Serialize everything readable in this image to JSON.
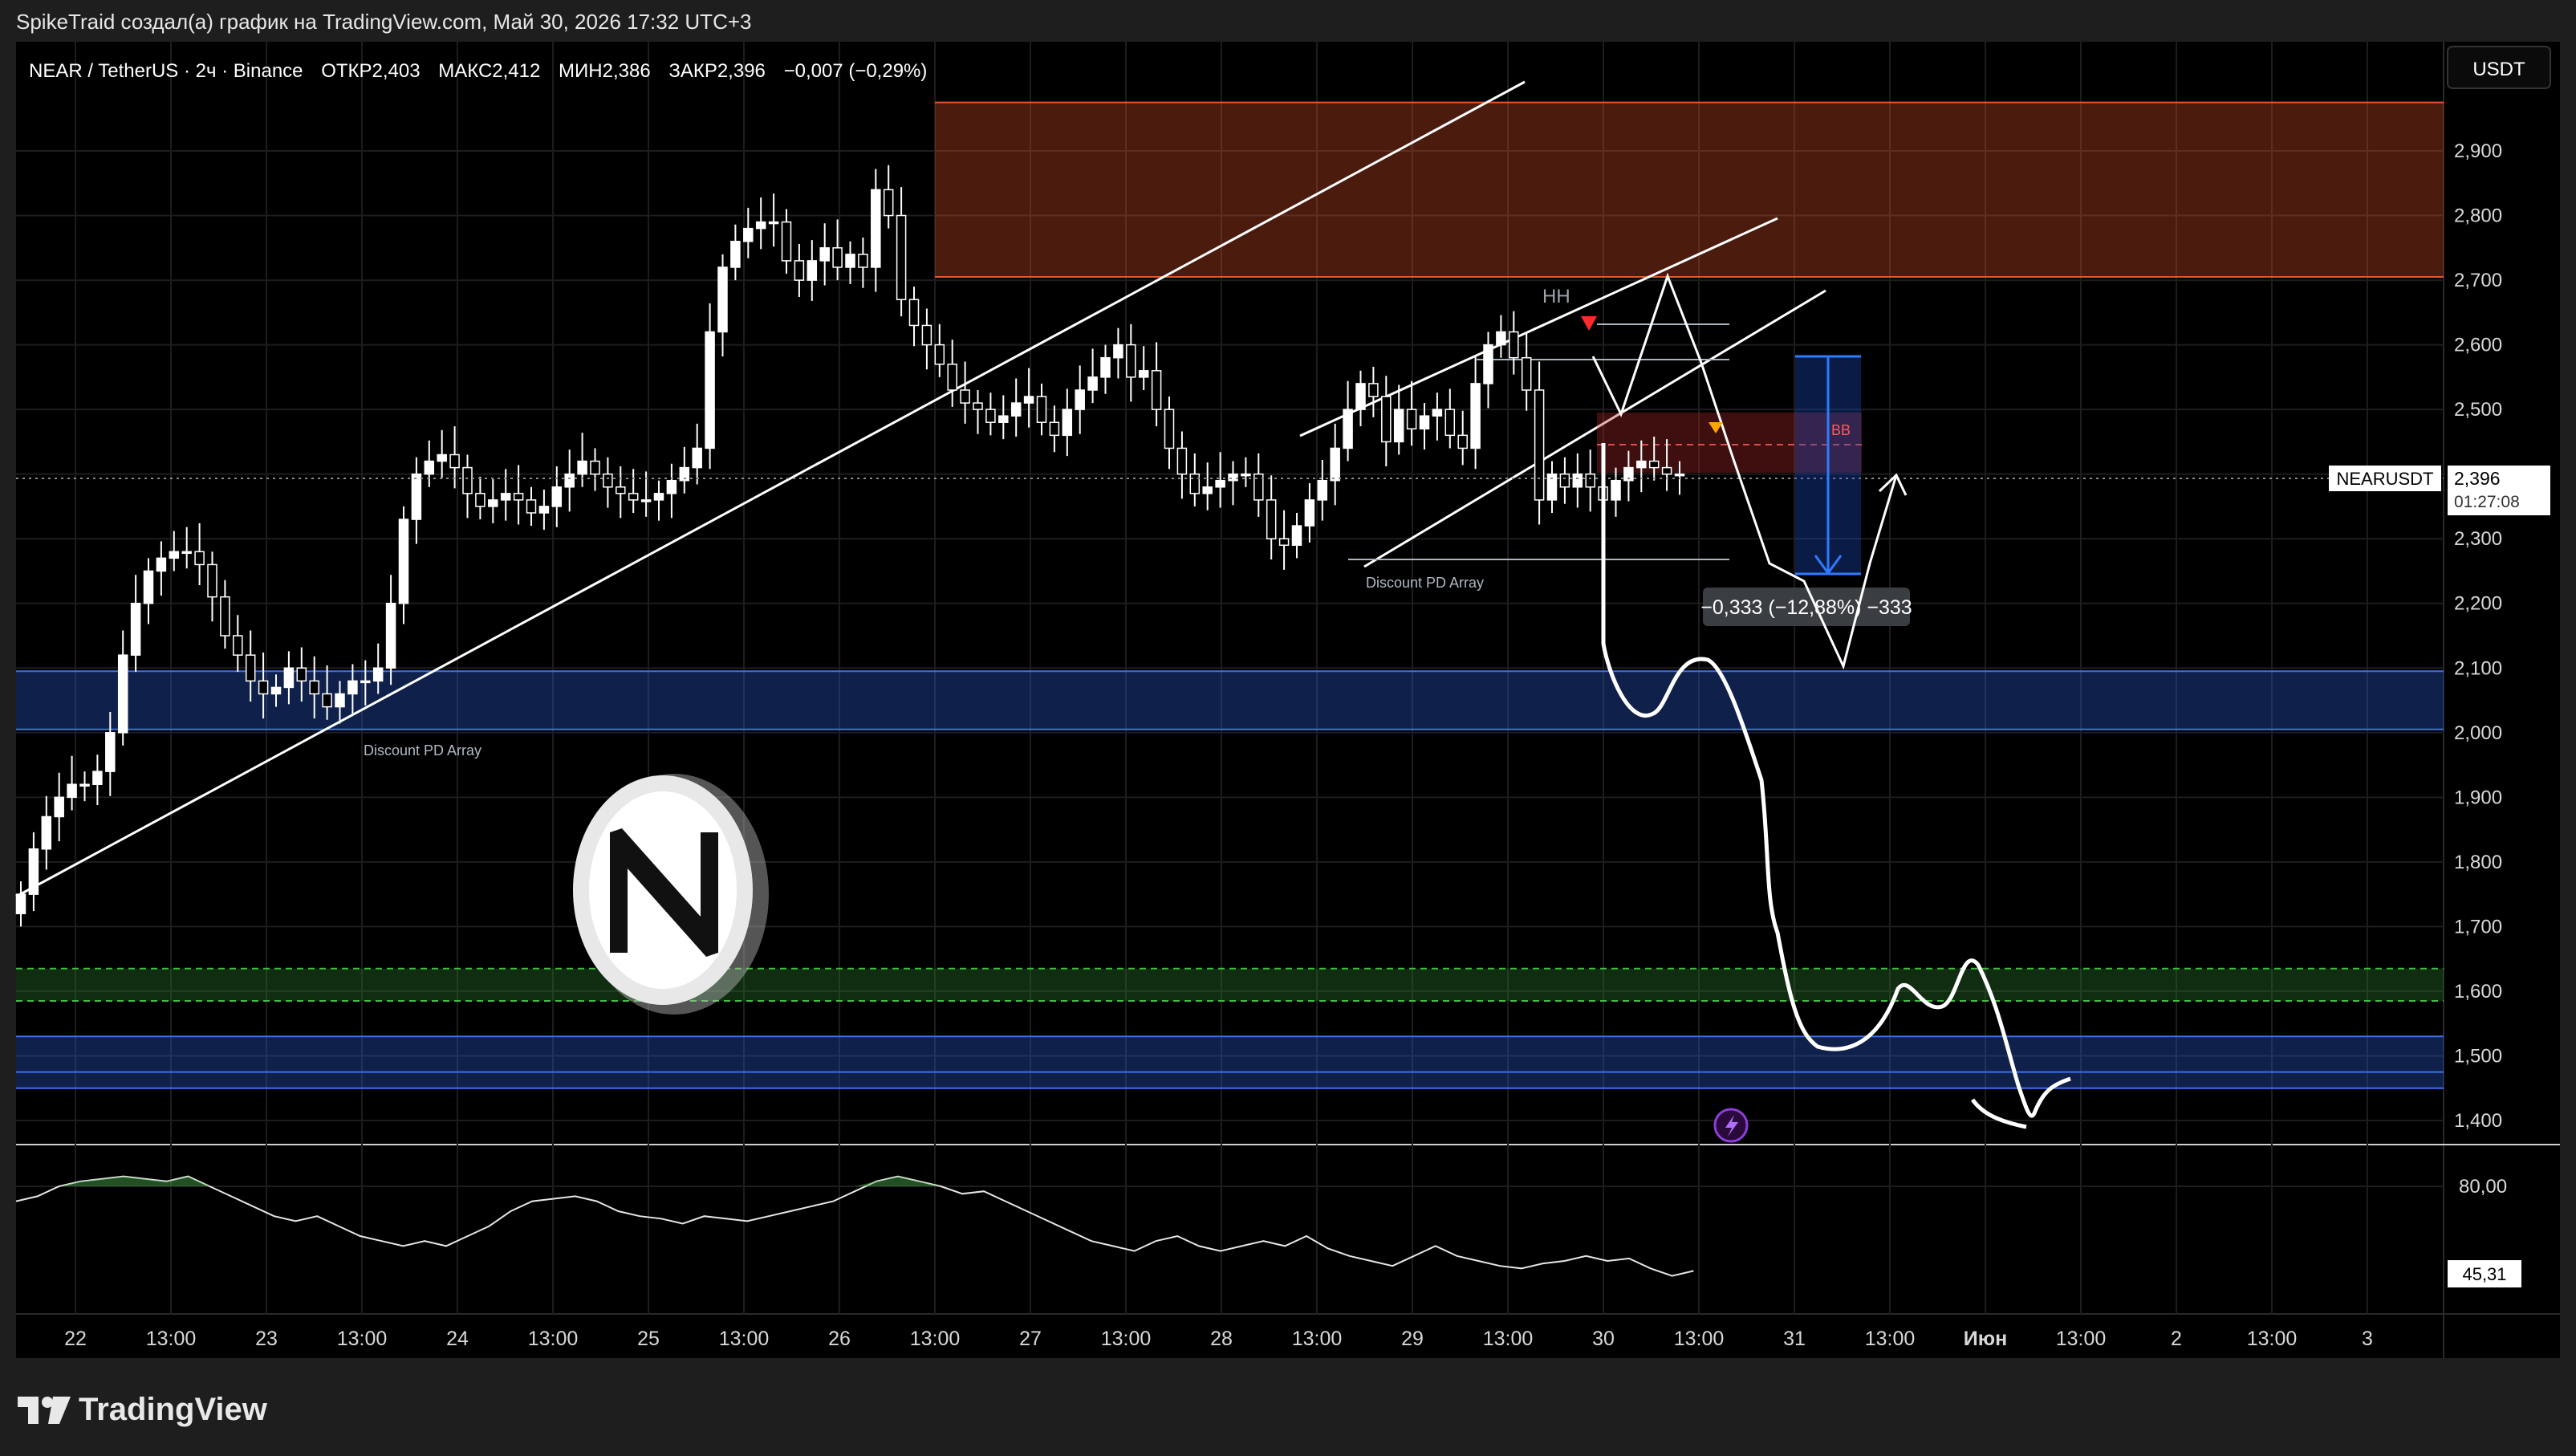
{
  "header": {
    "caption": "SpikeTraid создал(а) график на TradingView.com, Май 30, 2026 17:32 UTC+3"
  },
  "legend": {
    "symbol": "NEAR / TetherUS · 2ч · Binance",
    "open": "ОТКР2,403",
    "high": "МАКС2,412",
    "low": "МИН2,386",
    "close": "ЗАКР2,396",
    "change": "−0,007 (−0,29%)"
  },
  "currency_button": "USDT",
  "price_label": {
    "ticker": "NEARUSDT",
    "price": "2,396",
    "countdown": "01:27:08"
  },
  "annotations": {
    "hh": "HH",
    "bb": "BB",
    "discount_1": "Discount PD Array",
    "discount_2": "Discount PD Array",
    "measure": "−0,333 (−12,88%) −333"
  },
  "indicator": {
    "value": "45,31"
  },
  "brand": {
    "name": "TradingView"
  },
  "colors": {
    "background": "#000000",
    "candle": "#ffffff",
    "supply_zone": "#e8552a",
    "demand_zone": "#2a5bd7",
    "green_zone": "#2e7d32",
    "projection": "#ffffff"
  },
  "chart_data": {
    "type": "candlestick",
    "y_axis": {
      "min": 1.35,
      "max": 2.95,
      "ticks": [
        "2,900",
        "2,800",
        "2,700",
        "2,600",
        "2,500",
        "2,400",
        "2,300",
        "2,200",
        "2,100",
        "2,000",
        "1,900",
        "1,800",
        "1,700",
        "1,600",
        "1,500",
        "1,400"
      ]
    },
    "x_axis": {
      "ticks": [
        "22",
        "13:00",
        "23",
        "13:00",
        "24",
        "13:00",
        "25",
        "13:00",
        "26",
        "13:00",
        "27",
        "13:00",
        "28",
        "13:00",
        "29",
        "13:00",
        "30",
        "13:00",
        "31",
        "13:00",
        "Июн",
        "13:00",
        "2",
        "13:00",
        "3"
      ]
    },
    "indicator_axis": {
      "ticks": [
        "80,00"
      ]
    },
    "candles_close": [
      1.75,
      1.82,
      1.87,
      1.9,
      1.92,
      1.92,
      1.94,
      2.0,
      2.12,
      2.2,
      2.25,
      2.27,
      2.28,
      2.28,
      2.26,
      2.21,
      2.15,
      2.12,
      2.08,
      2.06,
      2.07,
      2.1,
      2.08,
      2.06,
      2.04,
      2.06,
      2.08,
      2.08,
      2.1,
      2.2,
      2.33,
      2.4,
      2.42,
      2.43,
      2.41,
      2.37,
      2.35,
      2.36,
      2.37,
      2.36,
      2.34,
      2.35,
      2.38,
      2.4,
      2.42,
      2.4,
      2.38,
      2.37,
      2.36,
      2.36,
      2.37,
      2.39,
      2.41,
      2.44,
      2.62,
      2.72,
      2.76,
      2.78,
      2.79,
      2.79,
      2.73,
      2.7,
      2.73,
      2.75,
      2.72,
      2.74,
      2.72,
      2.84,
      2.8,
      2.67,
      2.63,
      2.6,
      2.57,
      2.53,
      2.51,
      2.5,
      2.48,
      2.49,
      2.51,
      2.52,
      2.48,
      2.46,
      2.5,
      2.53,
      2.55,
      2.58,
      2.6,
      2.55,
      2.56,
      2.5,
      2.44,
      2.4,
      2.37,
      2.38,
      2.39,
      2.4,
      2.4,
      2.36,
      2.3,
      2.29,
      2.32,
      2.36,
      2.39,
      2.44,
      2.5,
      2.54,
      2.52,
      2.45,
      2.5,
      2.47,
      2.49,
      2.5,
      2.46,
      2.44,
      2.54,
      2.6,
      2.62,
      2.58,
      2.53,
      2.36,
      2.4,
      2.38,
      2.4,
      2.38,
      2.36,
      2.39,
      2.41,
      2.42,
      2.41,
      2.4,
      2.4
    ],
    "indicator_values": [
      74,
      76,
      80,
      82,
      83,
      84,
      83,
      82,
      84,
      80,
      76,
      72,
      68,
      66,
      68,
      64,
      60,
      58,
      56,
      58,
      56,
      60,
      64,
      70,
      74,
      75,
      76,
      74,
      70,
      68,
      67,
      65,
      68,
      67,
      66,
      68,
      70,
      72,
      74,
      78,
      82,
      84,
      82,
      80,
      77,
      78,
      74,
      70,
      66,
      62,
      58,
      56,
      54,
      58,
      60,
      56,
      54,
      56,
      58,
      56,
      60,
      55,
      52,
      50,
      48,
      52,
      56,
      52,
      50,
      48,
      47,
      49,
      50,
      52,
      50,
      51,
      47,
      44,
      46
    ],
    "zones": [
      {
        "kind": "supply",
        "from": 2.705,
        "to": 2.975
      },
      {
        "kind": "demand",
        "from": 2.005,
        "to": 2.095
      },
      {
        "kind": "green",
        "from": 1.585,
        "to": 1.635
      },
      {
        "kind": "demand",
        "from": 1.45,
        "to": 1.53
      }
    ]
  }
}
